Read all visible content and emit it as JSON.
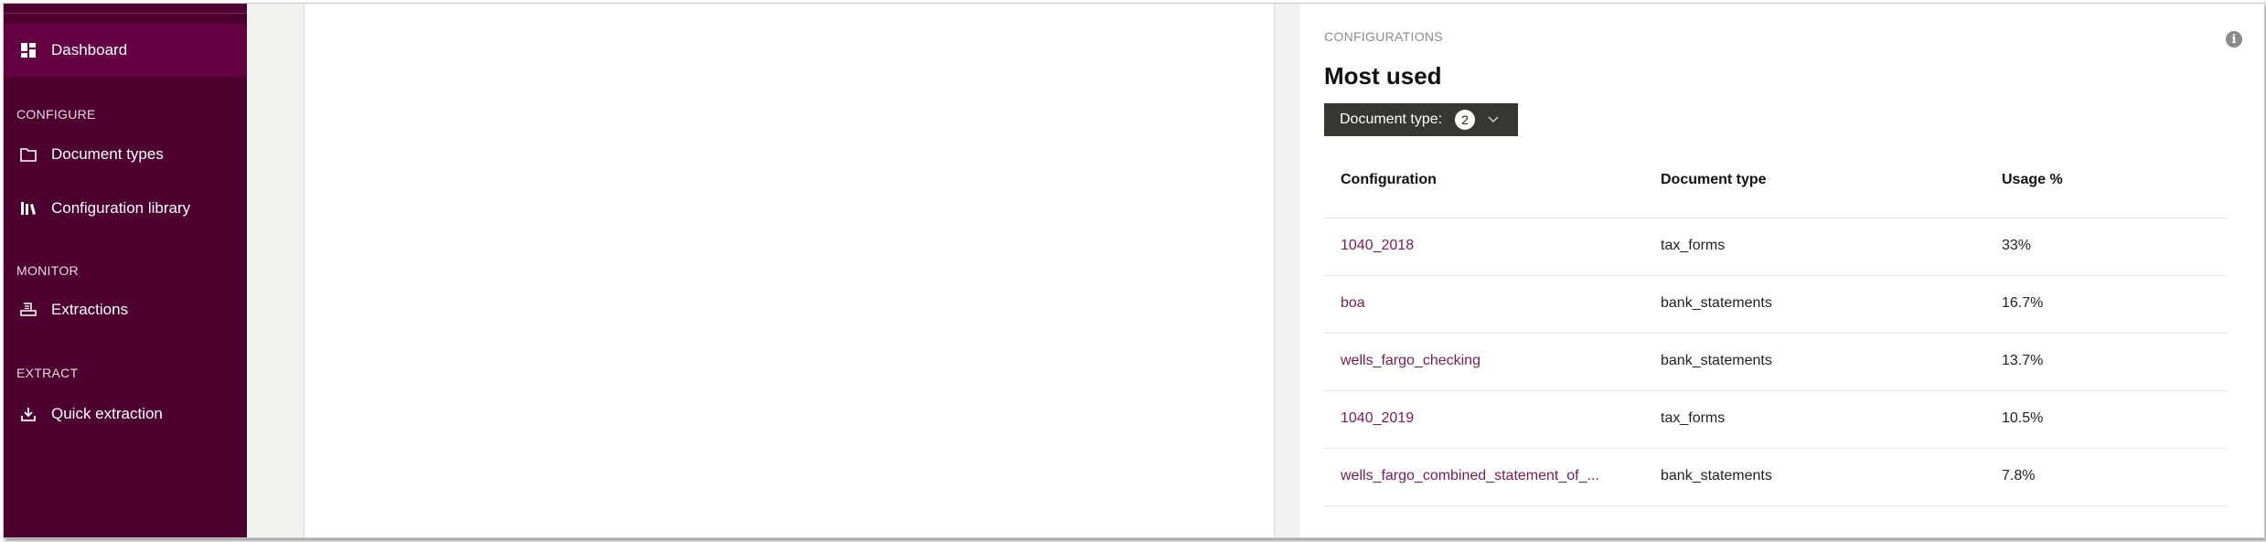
{
  "sidebar": {
    "items": [
      {
        "label": "Dashboard",
        "icon": "dashboard-icon",
        "active": true
      },
      {
        "label": "Document types",
        "icon": "folder-icon"
      },
      {
        "label": "Configuration library",
        "icon": "library-icon"
      },
      {
        "label": "Extractions",
        "icon": "scanner-icon"
      },
      {
        "label": "Quick extraction",
        "icon": "download-icon"
      }
    ],
    "sections": {
      "configure": "CONFIGURE",
      "monitor": "MONITOR",
      "extract": "EXTRACT"
    }
  },
  "panel": {
    "overline": "CONFIGURATIONS",
    "title": "Most used",
    "info_icon": "info-icon",
    "filter": {
      "label": "Document type:",
      "count": "2"
    },
    "table": {
      "headers": [
        "Configuration",
        "Document type",
        "Usage %"
      ],
      "rows": [
        {
          "configuration": "1040_2018",
          "document_type": "tax_forms",
          "usage": "33%"
        },
        {
          "configuration": "boa",
          "document_type": "bank_statements",
          "usage": "16.7%"
        },
        {
          "configuration": "wells_fargo_checking",
          "document_type": "bank_statements",
          "usage": "13.7%"
        },
        {
          "configuration": "1040_2019",
          "document_type": "tax_forms",
          "usage": "10.5%"
        },
        {
          "configuration": "wells_fargo_combined_statement_of_...",
          "document_type": "bank_statements",
          "usage": "7.8%"
        }
      ]
    }
  },
  "colors": {
    "sidebar_bg": "#4d0030",
    "sidebar_active": "#650042",
    "link": "#7a1a5a",
    "filter_bg": "#363732"
  }
}
